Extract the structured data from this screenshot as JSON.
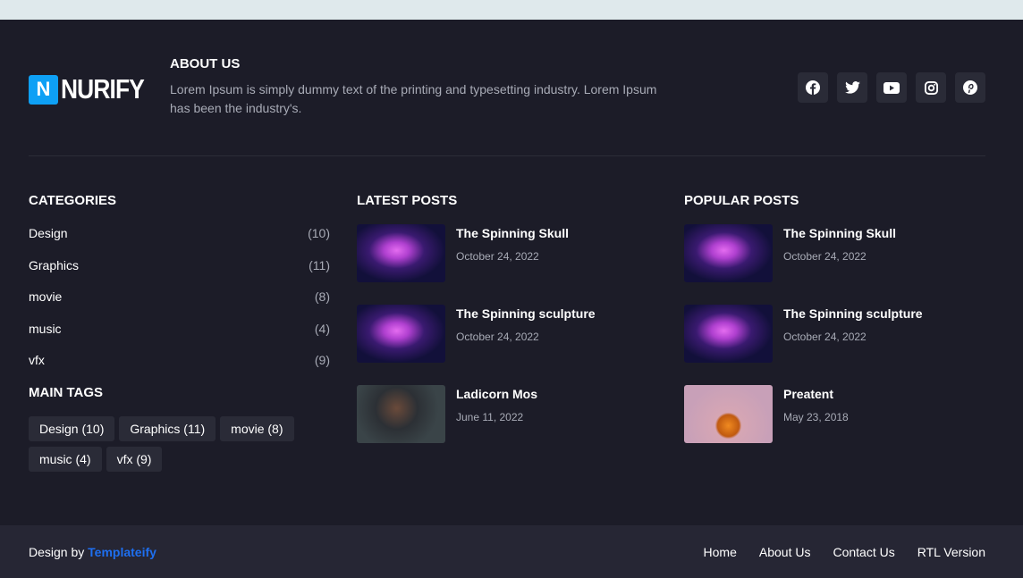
{
  "brand": {
    "logo_letter": "N",
    "logo_text": "NURIFY",
    "accent": "#0ea0f5"
  },
  "about": {
    "title": "ABOUT US",
    "text": "Lorem Ipsum is simply dummy text of the printing and typesetting industry. Lorem Ipsum has been the industry's."
  },
  "social": [
    "facebook-icon",
    "twitter-icon",
    "youtube-icon",
    "instagram-icon",
    "pinterest-icon"
  ],
  "categories": {
    "title": "CATEGORIES",
    "items": [
      {
        "label": "Design",
        "count": "(10)"
      },
      {
        "label": "Graphics",
        "count": "(11)"
      },
      {
        "label": "movie",
        "count": "(8)"
      },
      {
        "label": "music",
        "count": "(4)"
      },
      {
        "label": "vfx",
        "count": "(9)"
      }
    ]
  },
  "tags": {
    "title": "MAIN TAGS",
    "items": [
      "Design (10)",
      "Graphics (11)",
      "movie (8)",
      "music (4)",
      "vfx (9)"
    ]
  },
  "latest": {
    "title": "LATEST POSTS",
    "items": [
      {
        "title": "The Spinning Skull",
        "date": "October 24, 2022"
      },
      {
        "title": "The Spinning sculpture",
        "date": "October 24, 2022"
      },
      {
        "title": "Ladicorn Mos",
        "date": "June 11, 2022"
      }
    ]
  },
  "popular": {
    "title": "POPULAR POSTS",
    "items": [
      {
        "title": "The Spinning Skull",
        "date": "October 24, 2022"
      },
      {
        "title": "The Spinning sculpture",
        "date": "October 24, 2022"
      },
      {
        "title": "Preatent",
        "date": "May 23, 2018"
      }
    ]
  },
  "bottom": {
    "design_by": "Design by ",
    "author": "Templateify",
    "author_color": "#1e6ff0",
    "links": [
      "Home",
      "About Us",
      "Contact Us",
      "RTL Version"
    ]
  }
}
